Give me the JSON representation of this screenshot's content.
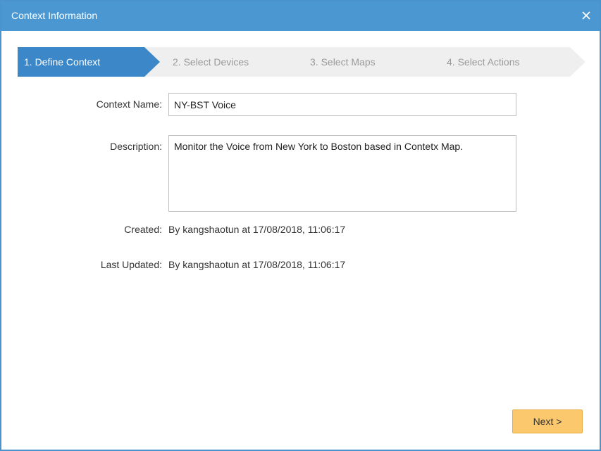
{
  "dialog": {
    "title": "Context Information",
    "close_icon": "close-icon"
  },
  "wizard": {
    "steps": [
      {
        "label": "1. Define Context",
        "active": true
      },
      {
        "label": "2. Select Devices",
        "active": false
      },
      {
        "label": "3. Select Maps",
        "active": false
      },
      {
        "label": "4. Select Actions",
        "active": false
      }
    ]
  },
  "form": {
    "context_name_label": "Context Name:",
    "context_name_value": "NY-BST Voice",
    "description_label": "Description:",
    "description_value": "Monitor the Voice from New York to Boston based in Contetx Map.",
    "created_label": "Created:",
    "created_value": "By kangshaotun at 17/08/2018, 11:06:17",
    "last_updated_label": "Last Updated:",
    "last_updated_value": "By kangshaotun at 17/08/2018, 11:06:17"
  },
  "footer": {
    "next_label": "Next >"
  },
  "colors": {
    "titlebar": "#4a97d2",
    "active_step": "#3c87c8",
    "inactive_step": "#efefef",
    "next_button": "#fbc86d"
  }
}
